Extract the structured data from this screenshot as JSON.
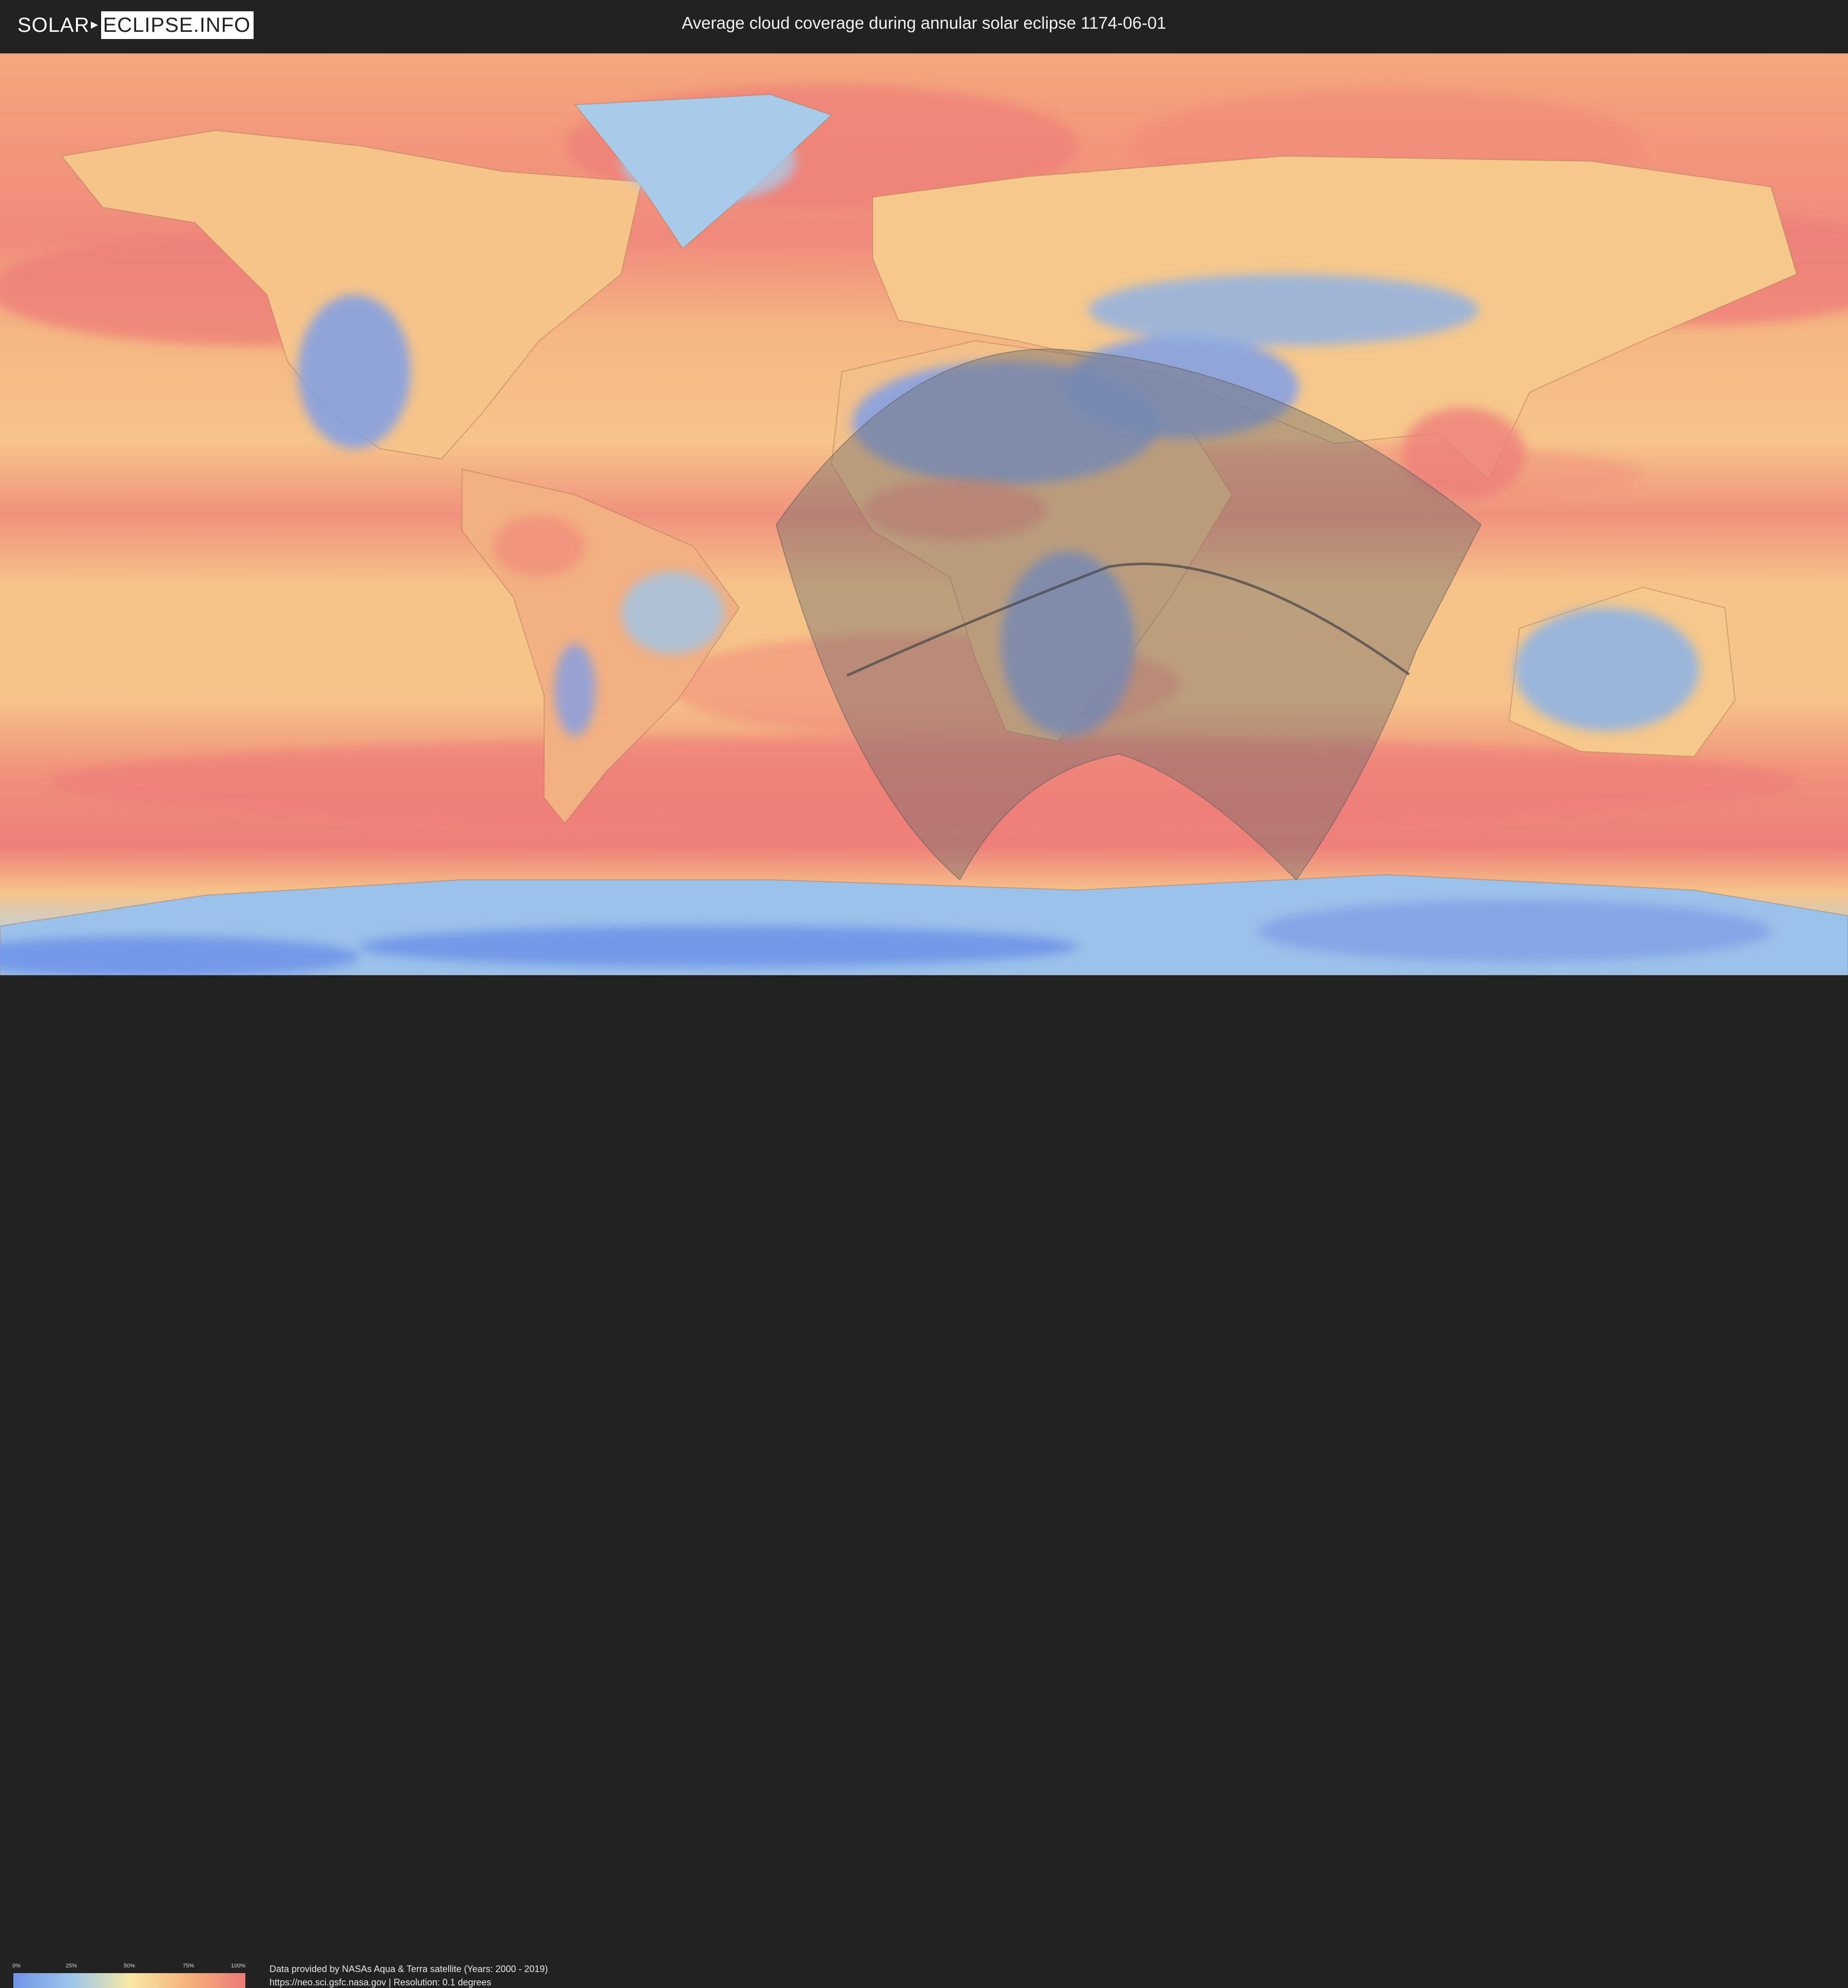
{
  "header": {
    "logo_part1": "SOLAR",
    "logo_part2": "ECLIPSE.INFO",
    "title": "Average cloud coverage during annular solar eclipse 1174-06-01"
  },
  "map": {
    "colors": {
      "low_cover": "#6f93e8",
      "mid_low": "#9cc6ea",
      "mid": "#f7e8a4",
      "mid_high": "#f6b27a",
      "high_cover": "#ee7a78",
      "eclipse_overlay": "#6b6b6b"
    }
  },
  "legend": {
    "ticks": [
      "0%",
      "25%",
      "50%",
      "75%",
      "100%"
    ]
  },
  "footer": {
    "credit_line1": "Data provided by NASAs Aqua & Terra satellite (Years: 2000 - 2019)",
    "credit_line2": "https://neo.sci.gsfc.nasa.gov | Resolution: 0.1 degrees"
  }
}
